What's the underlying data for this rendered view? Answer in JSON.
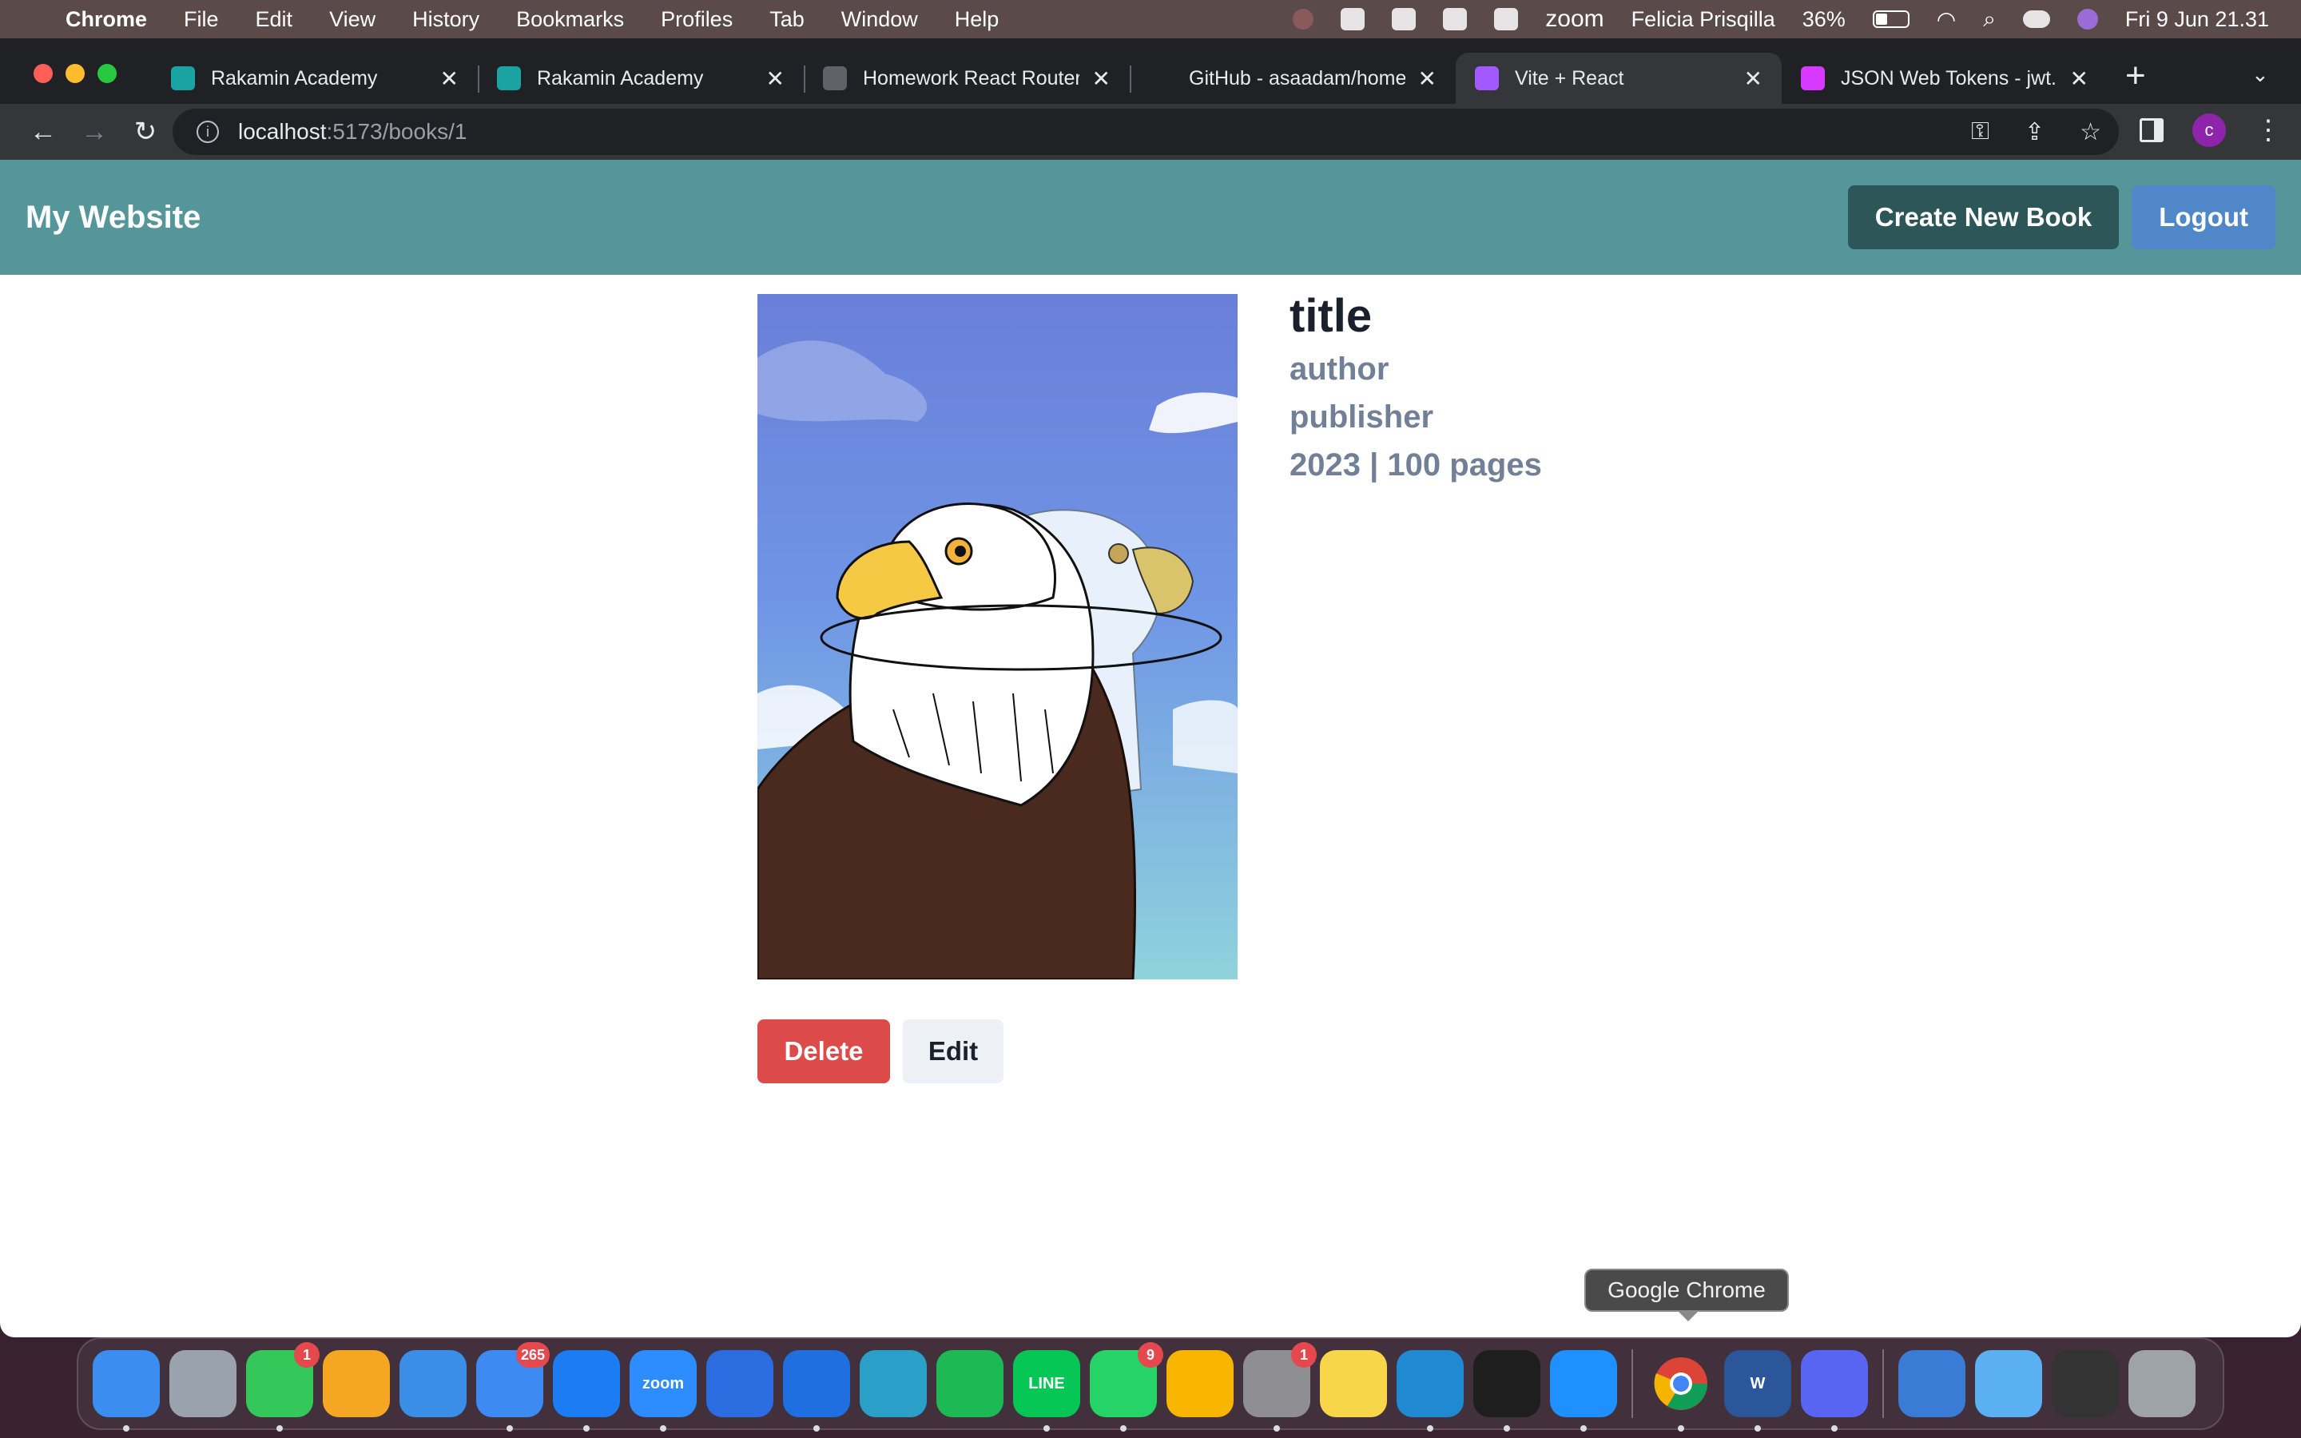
{
  "menubar": {
    "app": "Chrome",
    "items": [
      "File",
      "Edit",
      "View",
      "History",
      "Bookmarks",
      "Profiles",
      "Tab",
      "Window",
      "Help"
    ],
    "zoom_label": "zoom",
    "user": "Felicia Prisqilla",
    "battery": "36%",
    "datetime": "Fri 9 Jun  21.31"
  },
  "browser": {
    "tabs": [
      {
        "title": "Rakamin Academy",
        "icon": "rakamin-icon",
        "color": "#1aa3a3"
      },
      {
        "title": "Rakamin Academy",
        "icon": "rakamin-icon",
        "color": "#1aa3a3"
      },
      {
        "title": "Homework React Router",
        "icon": "globe-icon",
        "color": "#5f6368"
      },
      {
        "title": "GitHub - asaadam/homework",
        "icon": "github-icon",
        "color": "#202124"
      },
      {
        "title": "Vite + React",
        "icon": "vite-icon",
        "color": "#a259ff",
        "active": true
      },
      {
        "title": "JSON Web Tokens - jwt.io",
        "icon": "jwt-icon",
        "color": "#d63aff"
      }
    ],
    "url_host": "localhost",
    "url_path": ":5173/books/1",
    "profile_initial": "c"
  },
  "page": {
    "brand": "My Website",
    "create_button": "Create New Book",
    "logout_button": "Logout",
    "book": {
      "title": "title",
      "author": "author",
      "publisher": "publisher",
      "meta": "2023 | 100 pages"
    },
    "delete_button": "Delete",
    "edit_button": "Edit"
  },
  "dock": {
    "tooltip": "Google Chrome",
    "items": [
      {
        "name": "finder",
        "color": "#3b8ef0"
      },
      {
        "name": "launchpad",
        "color": "#9aa3ad"
      },
      {
        "name": "messages",
        "color": "#34c759",
        "badge": "1"
      },
      {
        "name": "photos",
        "color": "#f5a623"
      },
      {
        "name": "keynote",
        "color": "#3a8ee6"
      },
      {
        "name": "mail",
        "color": "#3d8bf2",
        "badge": "265"
      },
      {
        "name": "app-store",
        "color": "#1c7cf4"
      },
      {
        "name": "zoom",
        "color": "#2d8cff",
        "label": "zoom"
      },
      {
        "name": "xcode-simulator",
        "color": "#2b6de0"
      },
      {
        "name": "xcode",
        "color": "#1f6fe0"
      },
      {
        "name": "mindnode",
        "color": "#2aa0c8"
      },
      {
        "name": "spotify",
        "color": "#1db954"
      },
      {
        "name": "line",
        "color": "#06c755",
        "label": "LINE"
      },
      {
        "name": "whatsapp",
        "color": "#25d366",
        "badge": "9"
      },
      {
        "name": "sketch",
        "color": "#f7b500"
      },
      {
        "name": "system-settings",
        "color": "#8e8e93",
        "badge": "1"
      },
      {
        "name": "notes",
        "color": "#f7d64a"
      },
      {
        "name": "vscode",
        "color": "#1f8ad2"
      },
      {
        "name": "figma",
        "color": "#1e1e1e"
      },
      {
        "name": "safari",
        "color": "#1e90ff"
      },
      {
        "name": "chrome",
        "color": "#e8eaed"
      },
      {
        "name": "word",
        "color": "#2b579a",
        "label": "W"
      },
      {
        "name": "discord",
        "color": "#5865f2"
      },
      {
        "name": "network",
        "color": "#3a7bd5"
      },
      {
        "name": "downloads",
        "color": "#5ab0f0"
      },
      {
        "name": "screenshot",
        "color": "#333333"
      },
      {
        "name": "trash",
        "color": "#9ea3a8"
      }
    ]
  }
}
